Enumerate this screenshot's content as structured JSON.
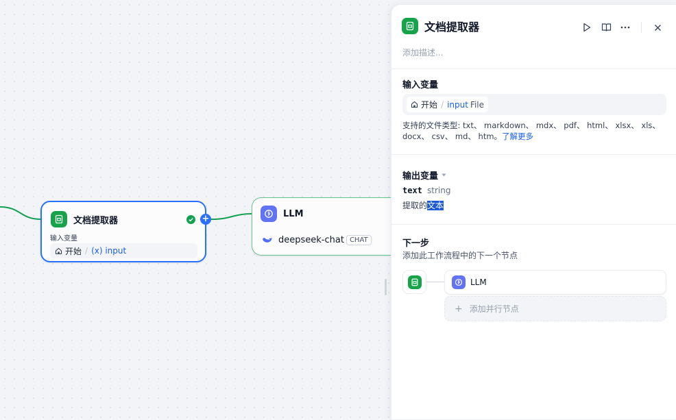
{
  "canvas": {
    "doc_node": {
      "title": "文档提取器",
      "sub_label": "输入变量",
      "var_source": "开始",
      "var_separator": "/",
      "var_name": "(x) input"
    },
    "llm_node": {
      "title": "LLM",
      "model": "deepseek-chat",
      "badge": "CHAT"
    }
  },
  "panel": {
    "title": "文档提取器",
    "description_placeholder": "添加描述...",
    "input_section": {
      "title": "输入变量",
      "var_source": "开始",
      "var_separator": "/",
      "var_name": "input",
      "var_type": "File",
      "support_text": "支持的文件类型: txt、 markdown、 mdx、 pdf、 html、 xlsx、 xls、 docx、 csv、 md、 htm。",
      "learn_more": "了解更多"
    },
    "output_section": {
      "title": "输出变量",
      "var_name": "text",
      "var_type": "string",
      "desc_prefix": "提取的",
      "desc_highlight": "文本"
    },
    "next_section": {
      "title": "下一步",
      "subtitle": "添加此工作流程中的下一个节点",
      "next_node": "LLM",
      "add_parallel": "添加并行节点"
    }
  },
  "colors": {
    "accent_blue": "#2970ff",
    "node_green": "#16a34a",
    "llm_indigo": "#6172f3",
    "edge_green": "#12a150",
    "success": "#12a150"
  }
}
